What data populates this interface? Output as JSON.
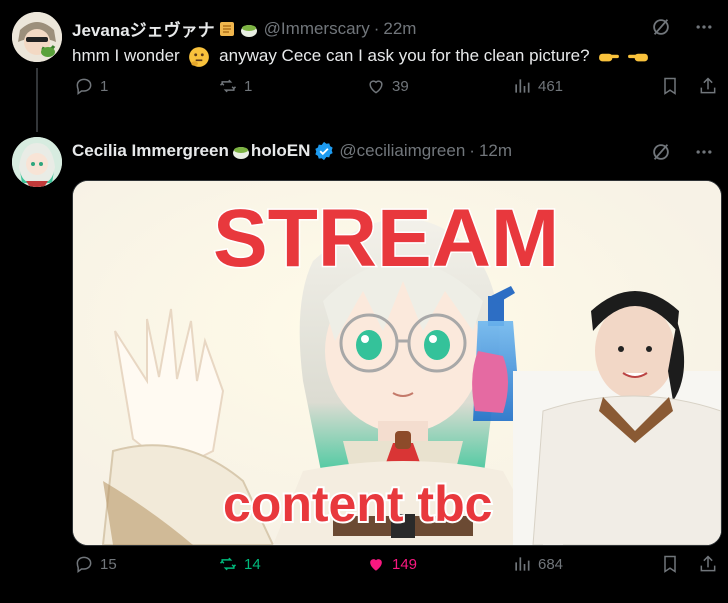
{
  "tweets": [
    {
      "author_name": "Jevanaジェヴァナ",
      "handle": "@Immerscary",
      "separator": "·",
      "time": "22m",
      "text_before": "hmm I wonder",
      "text_after": "anyway Cece can I ask you for the clean picture?",
      "actions": {
        "replies": "1",
        "retweets": "1",
        "likes": "39",
        "views": "461"
      }
    },
    {
      "author_name": "Cecilia Immergreen",
      "author_name_suffix": "holoEN",
      "verified": true,
      "handle": "@ceciliaimgreen",
      "separator": "·",
      "time": "12m",
      "media": {
        "headline_text": "STREAM",
        "bottom_text": "content tbc"
      },
      "actions": {
        "replies": "15",
        "retweets": "14",
        "likes": "149",
        "views": "684"
      }
    }
  ],
  "colors": {
    "background": "#000000",
    "muted": "#71767b",
    "retweet_active": "#00ba7c",
    "like_active": "#f91880",
    "verified": "#1d9bf0",
    "stream_text": "#e8383d"
  },
  "icons": [
    "grok-icon",
    "more-icon",
    "reply-icon",
    "retweet-icon",
    "heart-icon",
    "views-icon",
    "bookmark-icon",
    "share-icon",
    "scroll-emoji",
    "tea-emoji",
    "thinking-emoji",
    "pointing-right-emoji",
    "pointing-left-emoji",
    "verified-icon"
  ]
}
